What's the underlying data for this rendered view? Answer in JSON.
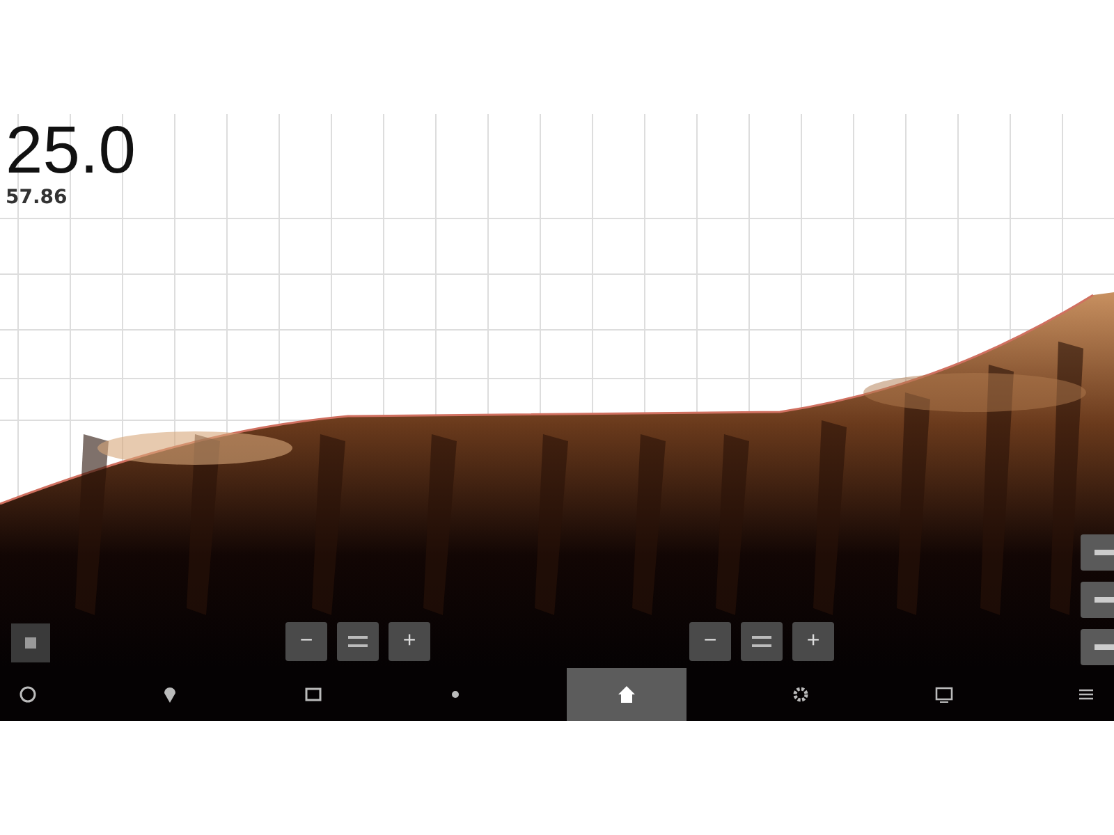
{
  "depth": {
    "value": "25.0",
    "secondary": "57.86"
  },
  "zoom_groups": [
    {
      "minus": "−",
      "plus": "+"
    },
    {
      "minus": "−",
      "plus": "+"
    }
  ],
  "side_buttons": [
    {
      "kind": "line"
    },
    {
      "kind": "line"
    },
    {
      "kind": "line"
    }
  ],
  "bottom_nav": [
    {
      "kind": "circle",
      "selected": false
    },
    {
      "kind": "pin",
      "selected": false
    },
    {
      "kind": "box",
      "selected": false
    },
    {
      "kind": "dot",
      "selected": false
    },
    {
      "kind": "home",
      "selected": true
    },
    {
      "kind": "gear",
      "selected": false
    },
    {
      "kind": "screen",
      "selected": false
    },
    {
      "kind": "menu",
      "selected": false
    }
  ]
}
